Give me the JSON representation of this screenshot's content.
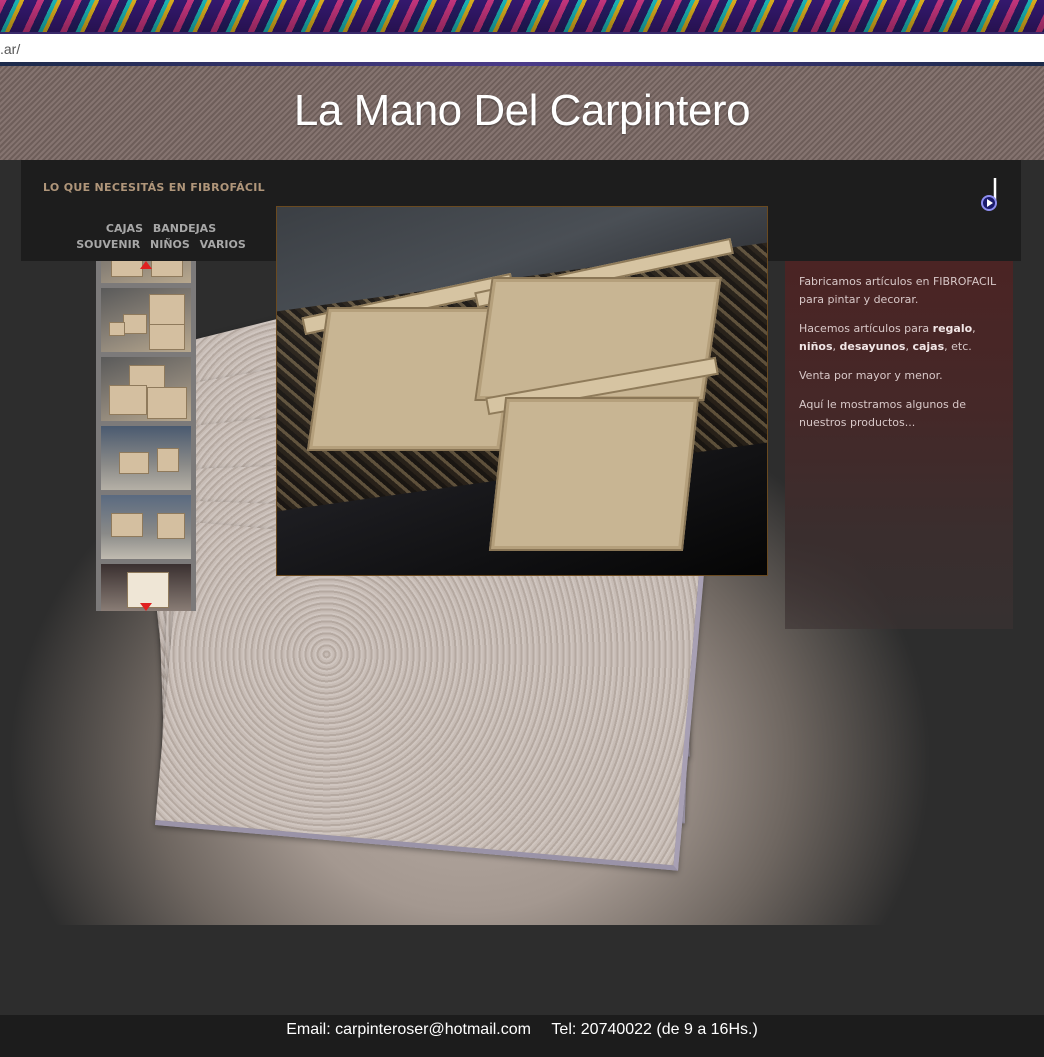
{
  "browser": {
    "url": ".ar/"
  },
  "header": {
    "title": "La Mano Del Carpintero"
  },
  "nav": {
    "heading": "LO QUE NECESITÁS EN FIBROFÁCIL",
    "links": [
      "CAJAS",
      "BANDEJAS",
      "SOUVENIR",
      "NIÑOS",
      "VARIOS"
    ],
    "music_icon": "music-note-icon"
  },
  "gallery": {
    "thumbnail_count": 6,
    "scroll_up_icon": "arrow-up-icon",
    "scroll_down_icon": "arrow-down-icon"
  },
  "description": {
    "p1": "Fabricamos artículos en FIBROFACIL para pintar y decorar.",
    "p2_prefix": "Hacemos artículos para ",
    "p2_items": [
      "regalo",
      "niños",
      "desayunos",
      "cajas"
    ],
    "p2_suffix": ", etc.",
    "p3": "Venta por mayor y menor.",
    "p4": "Aquí le mostramos algunos de nuestros productos..."
  },
  "footer": {
    "email": "Email: carpinteroser@hotmail.com",
    "phone": "Tel: 20740022 (de 9 a 16Hs.)"
  },
  "colors": {
    "nav_heading": "#b0967a",
    "nav_links": "#a7a7a7",
    "panel": "#4b2424",
    "scroll_arrow": "#e02020"
  }
}
